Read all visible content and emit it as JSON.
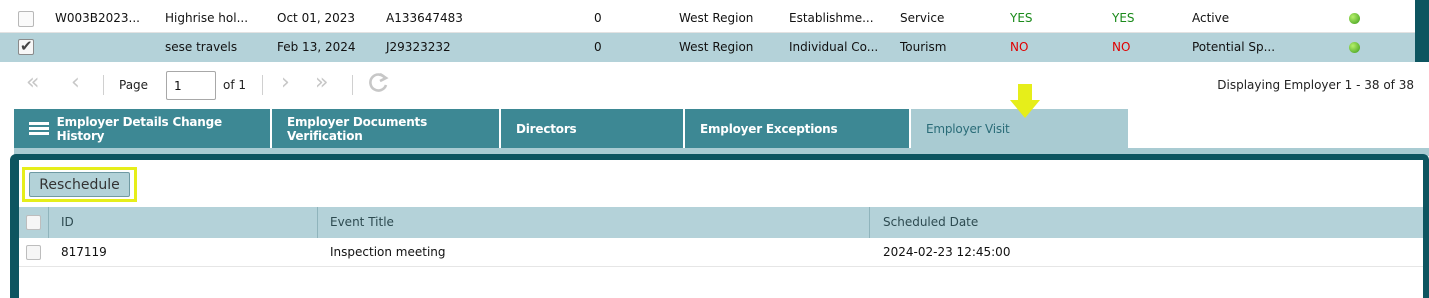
{
  "grid": {
    "rows": [
      {
        "checked": false,
        "code": "W003B2023...",
        "name": "Highrise hol...",
        "date": "Oct 01, 2023",
        "reg_no": "A133647483",
        "count": "0",
        "region": "West Region",
        "type": "Establishme...",
        "sector": "Service",
        "flag1": "YES",
        "flag2": "YES",
        "status": "Active"
      },
      {
        "checked": true,
        "code": "",
        "name": "sese travels",
        "date": "Feb 13, 2024",
        "reg_no": "J29323232",
        "count": "0",
        "region": "West Region",
        "type": "Individual Co...",
        "sector": "Tourism",
        "flag1": "NO",
        "flag2": "NO",
        "status": "Potential Sp..."
      }
    ]
  },
  "pager": {
    "page_label": "Page",
    "page_value": "1",
    "of_label": "of 1",
    "display_text": "Displaying Employer 1 - 38 of 38"
  },
  "tabs": [
    {
      "label": "Employer Details Change History",
      "active": false
    },
    {
      "label": "Employer Documents Verification",
      "active": false
    },
    {
      "label": "Directors",
      "active": false
    },
    {
      "label": "Employer Exceptions",
      "active": false
    },
    {
      "label": "Employer Visit",
      "active": true
    }
  ],
  "visit": {
    "reschedule_label": "Reschedule",
    "columns": [
      "ID",
      "Event Title",
      "Scheduled Date"
    ],
    "rows": [
      {
        "id": "817119",
        "title": "Inspection meeting",
        "date": "2024-02-23 12:45:00"
      }
    ]
  },
  "colors": {
    "teal_dark": "#0d5560",
    "tab_teal": "#3d8894",
    "tab_active": "#a9cbd2",
    "highlight_yellow": "#e6ee1a",
    "yes_green": "#1a8a1a",
    "no_red": "#e00000"
  }
}
